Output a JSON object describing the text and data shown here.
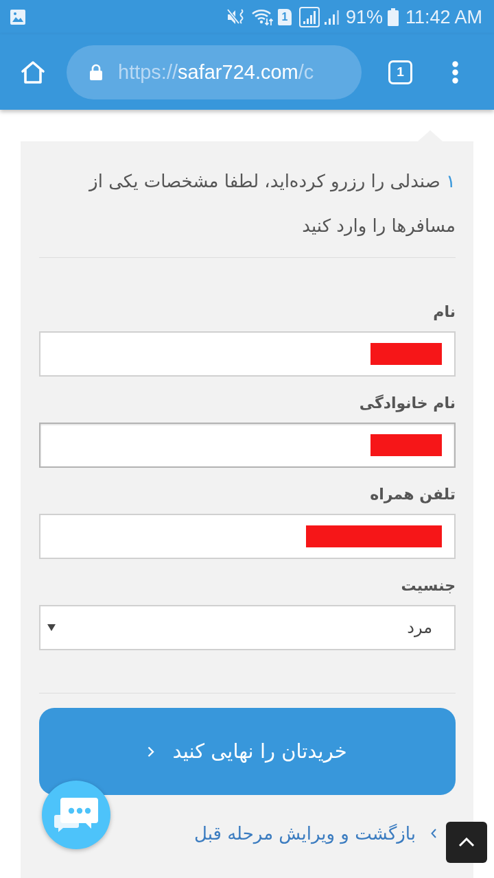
{
  "status_bar": {
    "sim_badge": "1",
    "battery": "91%",
    "time": "11:42 AM"
  },
  "browser_toolbar": {
    "url": {
      "scheme": "https://",
      "host": "safar724.com",
      "path": "/c"
    },
    "tab_count": "1"
  },
  "intro": {
    "count": "۱",
    "text": "صندلی را رزرو کرده‌اید، لطفا مشخصات یکی از مسافرها را وارد کنید"
  },
  "fields": [
    {
      "kind": "text",
      "label": "نام",
      "redacted": true,
      "focused": false
    },
    {
      "kind": "text",
      "label": "نام خانوادگی",
      "redacted": true,
      "focused": true
    },
    {
      "kind": "tel",
      "label": "تلفن همراه",
      "redacted": true,
      "focused": false
    },
    {
      "kind": "select",
      "label": "جنسیت",
      "value": "مرد"
    }
  ],
  "submit_button": {
    "label": "خریدتان را نهایی کنید"
  },
  "back_link": {
    "label": "بازگشت و ویرایش مرحله قبل"
  }
}
